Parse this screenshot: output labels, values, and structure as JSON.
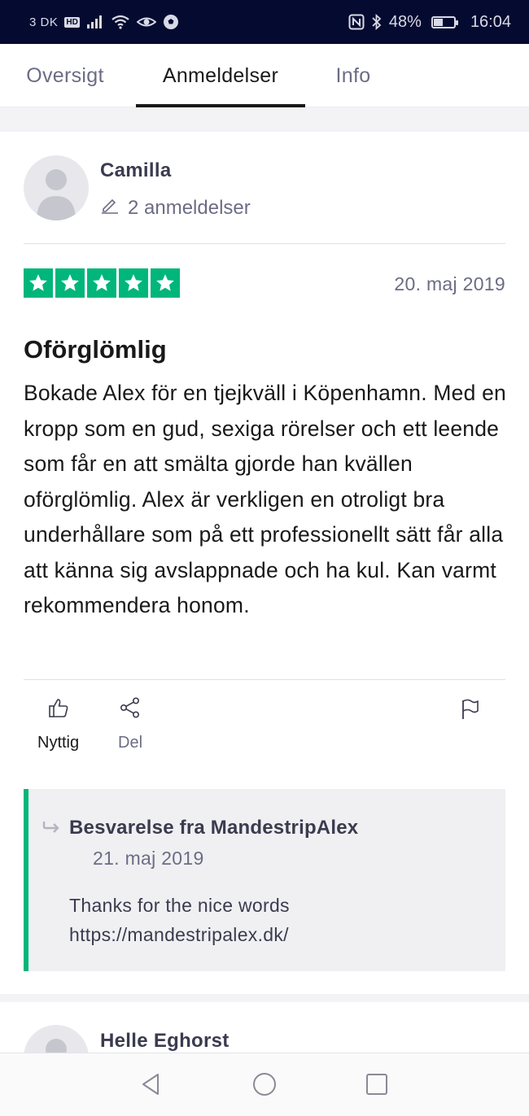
{
  "status_bar": {
    "carrier": "3 DK",
    "hd_badge": "HD",
    "battery_percent": "48%",
    "battery_level": 0.48,
    "time": "16:04",
    "icons": [
      "signal-icon",
      "wifi-icon",
      "eye-icon",
      "football-icon",
      "nfc-icon",
      "bluetooth-icon",
      "battery-icon"
    ]
  },
  "tabs": [
    {
      "label": "Oversigt",
      "active": false
    },
    {
      "label": "Anmeldelser",
      "active": true
    },
    {
      "label": "Info",
      "active": false
    }
  ],
  "review": {
    "reviewer_name": "Camilla",
    "review_count": "2 anmeldelser",
    "rating": 5,
    "rating_color": "#00b67a",
    "date": "20. maj 2019",
    "title": "Oförglömlig",
    "body": "Bokade Alex för en tjejkväll i Köpenhamn. Med en kropp som en gud, sexiga rörelser och ett leende som får en att smälta gjorde han kvällen oförglömlig. Alex är verkligen en otroligt bra underhållare som på ett professionellt sätt får alla att känna sig avslappnade och ha kul. Kan varmt rekommendera honom.",
    "actions": {
      "useful_label": "Nyttig",
      "share_label": "Del"
    },
    "reply": {
      "title": "Besvarelse fra MandestripAlex",
      "date": "21. maj 2019",
      "text_line1": "Thanks for the nice words",
      "text_line2": "https://mandestripalex.dk/"
    }
  },
  "next_review": {
    "reviewer_name": "Helle Eghorst"
  },
  "nav_bar": {
    "buttons": [
      "back-icon",
      "home-icon",
      "recents-icon"
    ]
  }
}
